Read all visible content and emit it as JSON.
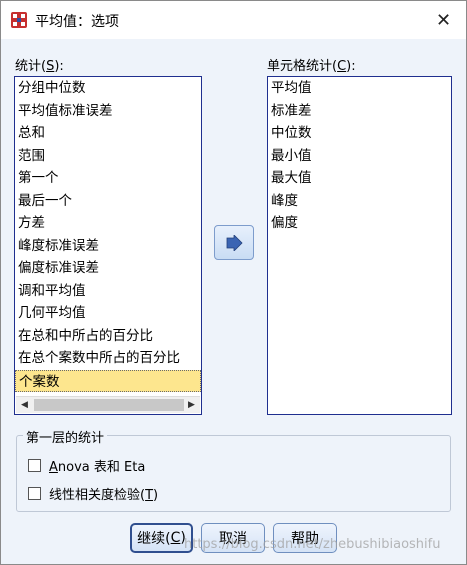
{
  "window": {
    "title": "平均值：选项",
    "close_glyph": "✕"
  },
  "stats": {
    "label_prefix": "统计(",
    "label_key": "S",
    "label_suffix": "):",
    "items": [
      "分组中位数",
      "平均值标准误差",
      "总和",
      "范围",
      "第一个",
      "最后一个",
      "方差",
      "峰度标准误差",
      "偏度标准误差",
      "调和平均值",
      "几何平均值",
      "在总和中所占的百分比",
      "在总个案数中所占的百分比",
      "个案数"
    ],
    "selected": "个案数"
  },
  "cell_stats": {
    "label_prefix": "单元格统计(",
    "label_key": "C",
    "label_suffix": "):",
    "items": [
      "平均值",
      "标准差",
      "中位数",
      "最小值",
      "最大值",
      "峰度",
      "偏度"
    ]
  },
  "first_layer": {
    "legend": "第一层的统计",
    "anova_key": "A",
    "anova_rest": "nova 表和 Eta",
    "linearity_prefix": "线性相关度检验(",
    "linearity_key": "T",
    "linearity_suffix": ")"
  },
  "buttons": {
    "continue_prefix": "继续(",
    "continue_key": "C",
    "continue_suffix": ")",
    "cancel": "取消",
    "help": "帮助"
  },
  "watermark": "https://blog.csdn.net/zhebushibiaoshifu",
  "colors": {
    "accent": "#1f2f8f",
    "selection": "#fde68e",
    "client_bg": "#eef3fa"
  }
}
